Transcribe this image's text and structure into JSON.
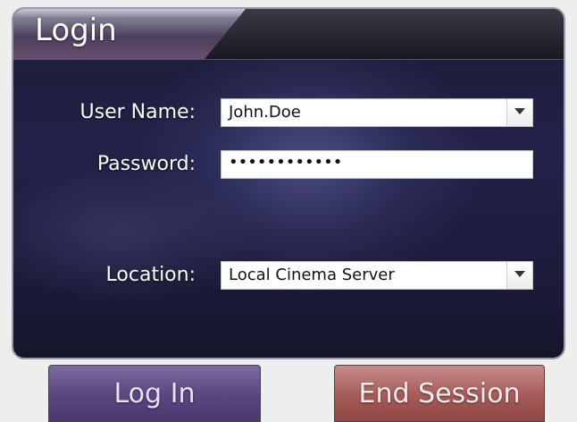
{
  "dialog": {
    "title": "Login"
  },
  "form": {
    "username_label": "User Name:",
    "username_value": "John.Doe",
    "password_label": "Password:",
    "password_value": "••••••••••••",
    "location_label": "Location:",
    "location_value": "Local Cinema Server"
  },
  "buttons": {
    "login_label": "Log In",
    "end_session_label": "End Session"
  },
  "colors": {
    "panel_background": "#1c1c3c",
    "login_button": "#5a4680",
    "end_session_button": "#a55b58"
  },
  "icons": {
    "username_dropdown": "chevron-down-icon",
    "location_dropdown": "chevron-down-icon"
  }
}
